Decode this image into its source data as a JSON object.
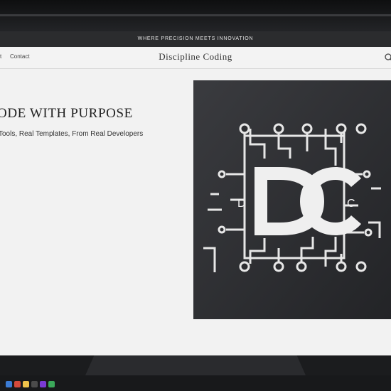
{
  "announcement": {
    "text": "WHERE PRECISION MEETS INNOVATION"
  },
  "nav": {
    "prev_link_fragment": "t",
    "contact_label": "Contact",
    "brand": "Discipline Coding",
    "search_icon": "search-icon"
  },
  "hero": {
    "title": "ODE WITH PURPOSE",
    "subtitle": "Tools, Real Templates, From Real Developers"
  },
  "logo": {
    "monogram": "DC",
    "left_letter": "D",
    "right_letter": "C"
  },
  "taskbar": {
    "icons": [
      "browser-icon",
      "app-icon",
      "app-icon",
      "app-icon",
      "app-icon",
      "app-icon",
      "app-icon"
    ],
    "colors": [
      "#3b7bd4",
      "#d44a3b",
      "#f0c24b",
      "#4b4b4b",
      "#7a3bd4",
      "#3ba85a",
      "#2f6fb0"
    ]
  },
  "colors": {
    "page_bg": "#f2f2f2",
    "announce_bg": "#2b2c2e",
    "logo_bg": "#2d2e31",
    "logo_stroke": "#e7e7e7"
  }
}
